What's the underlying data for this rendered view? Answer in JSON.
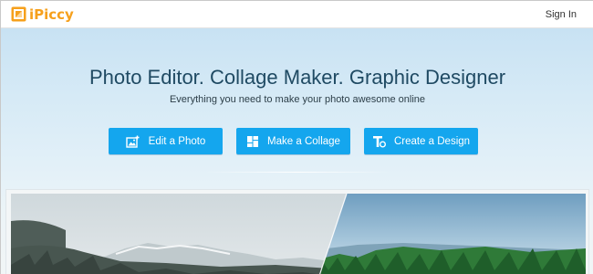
{
  "header": {
    "logo_text": "iPiccy",
    "sign_in": "Sign In"
  },
  "hero": {
    "title": "Photo Editor. Collage Maker. Graphic Designer",
    "subtitle": "Everything you need to make your photo awesome online",
    "buttons": [
      {
        "label": "Edit a Photo",
        "icon": "photo-edit-icon"
      },
      {
        "label": "Make a Collage",
        "icon": "collage-grid-icon"
      },
      {
        "label": "Create a Design",
        "icon": "text-design-icon"
      }
    ]
  },
  "colors": {
    "brand_orange": "#f6a01c",
    "cta_blue": "#14a6ee",
    "title_text": "#1f4a63"
  }
}
